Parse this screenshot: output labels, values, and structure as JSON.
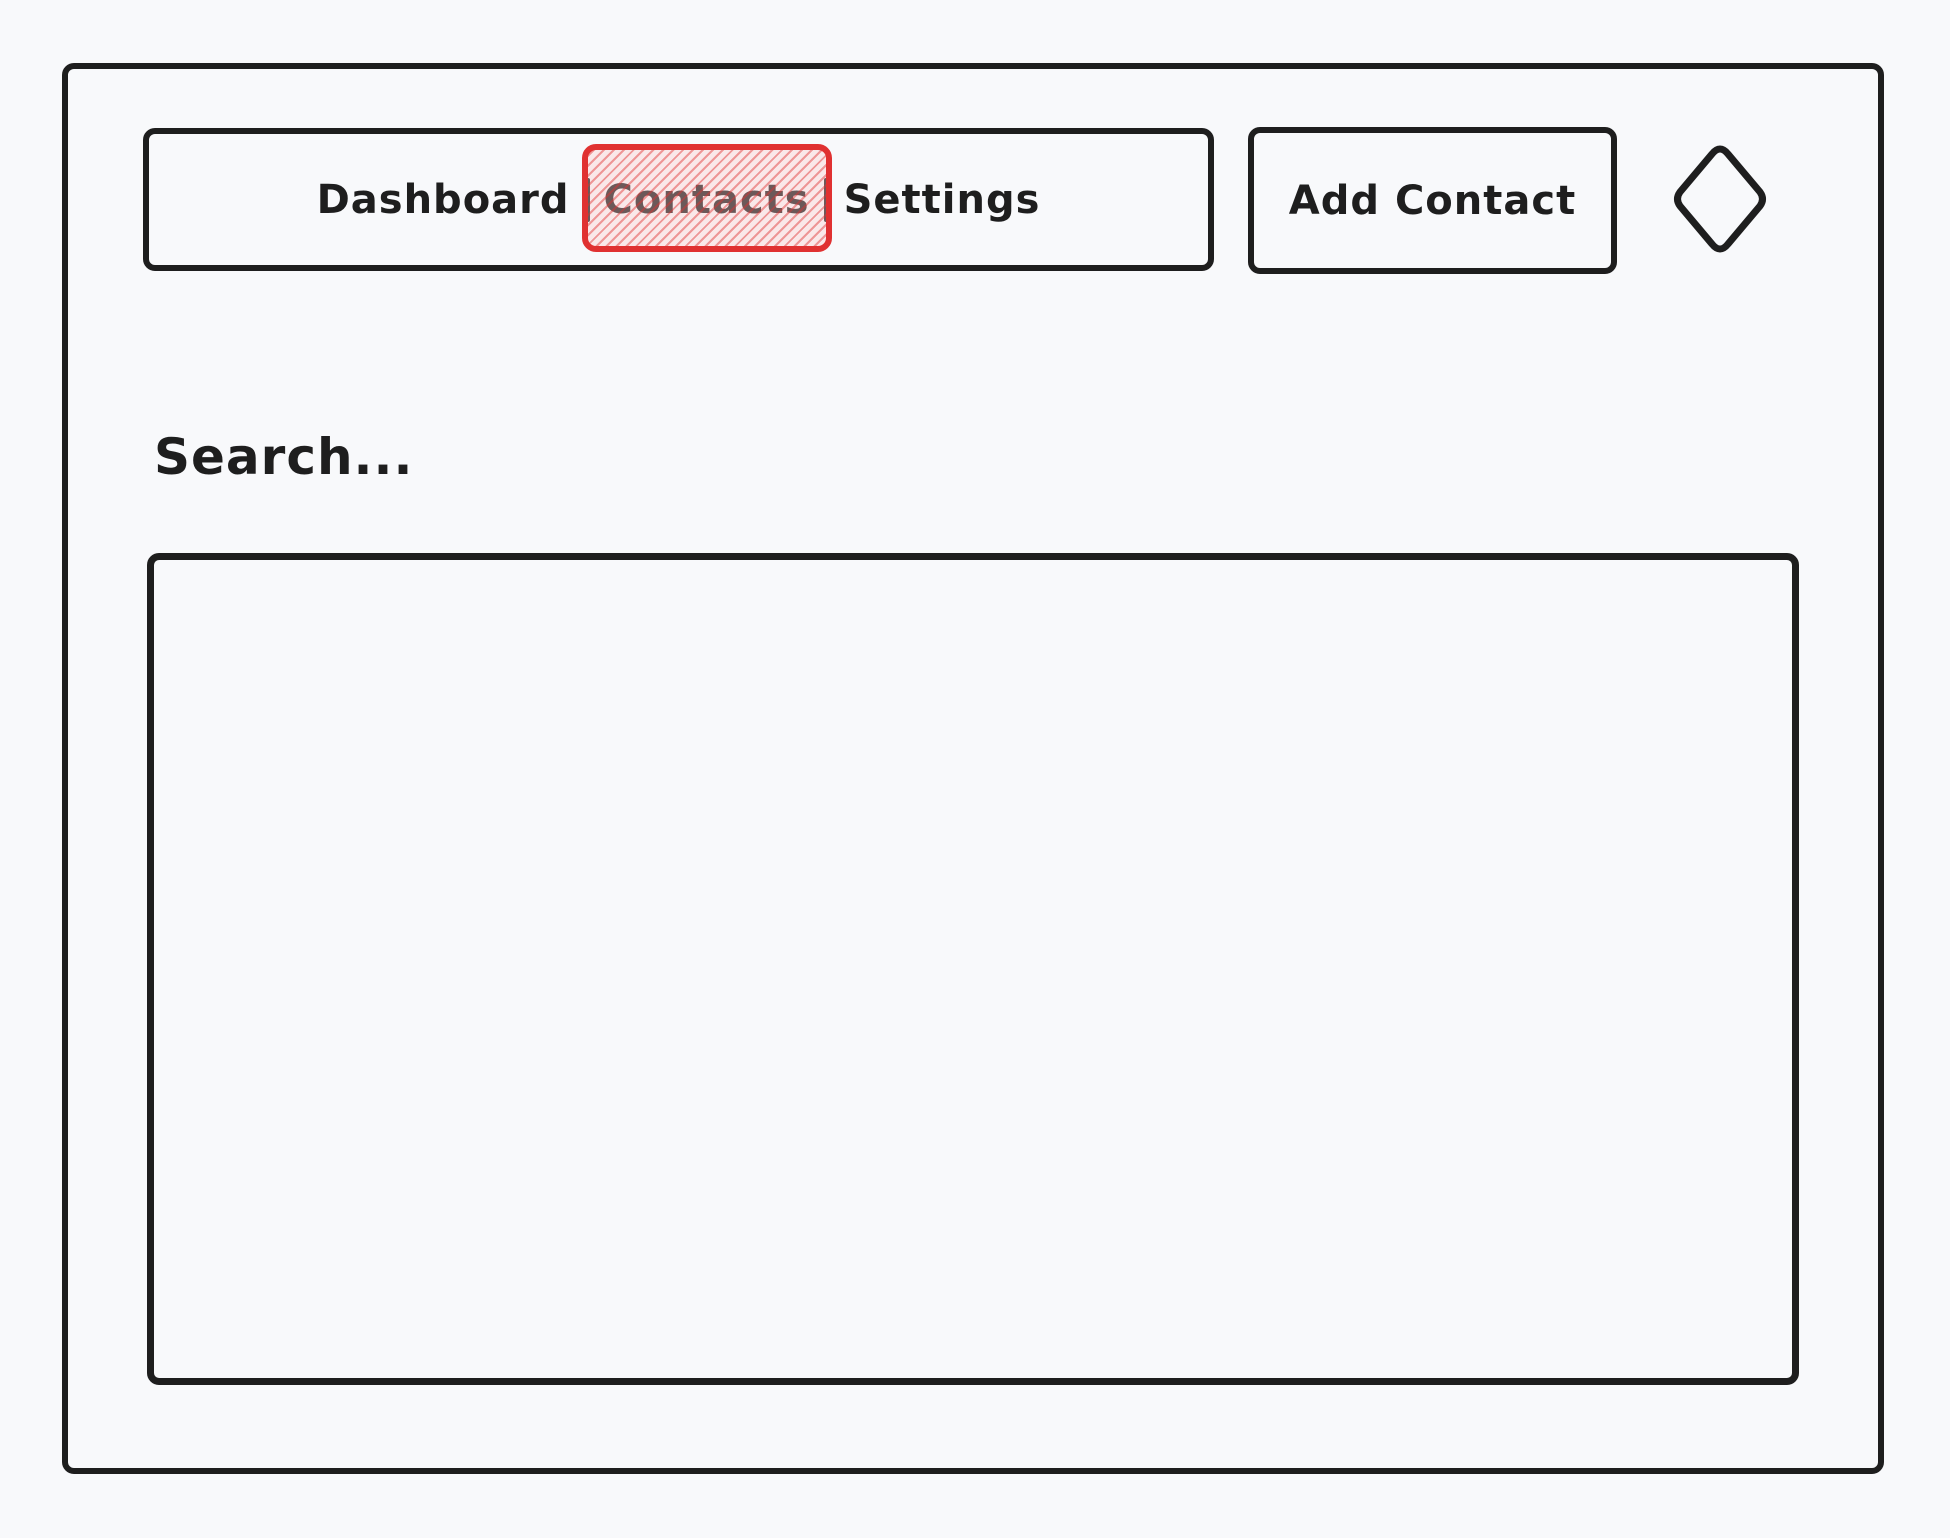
{
  "nav": {
    "items": [
      {
        "label": "Dashboard"
      },
      {
        "label": "Contacts",
        "selected": true
      },
      {
        "label": "Settings"
      }
    ],
    "highlight_color": "#e03131"
  },
  "toolbar": {
    "add_contact_label": "Add Contact"
  },
  "icons": {
    "menu_icon": "diamond-icon"
  },
  "search": {
    "label": "Search..."
  },
  "colors": {
    "stroke": "#1e1e1e",
    "background": "#f8f9fb",
    "accent": "#e03131"
  }
}
